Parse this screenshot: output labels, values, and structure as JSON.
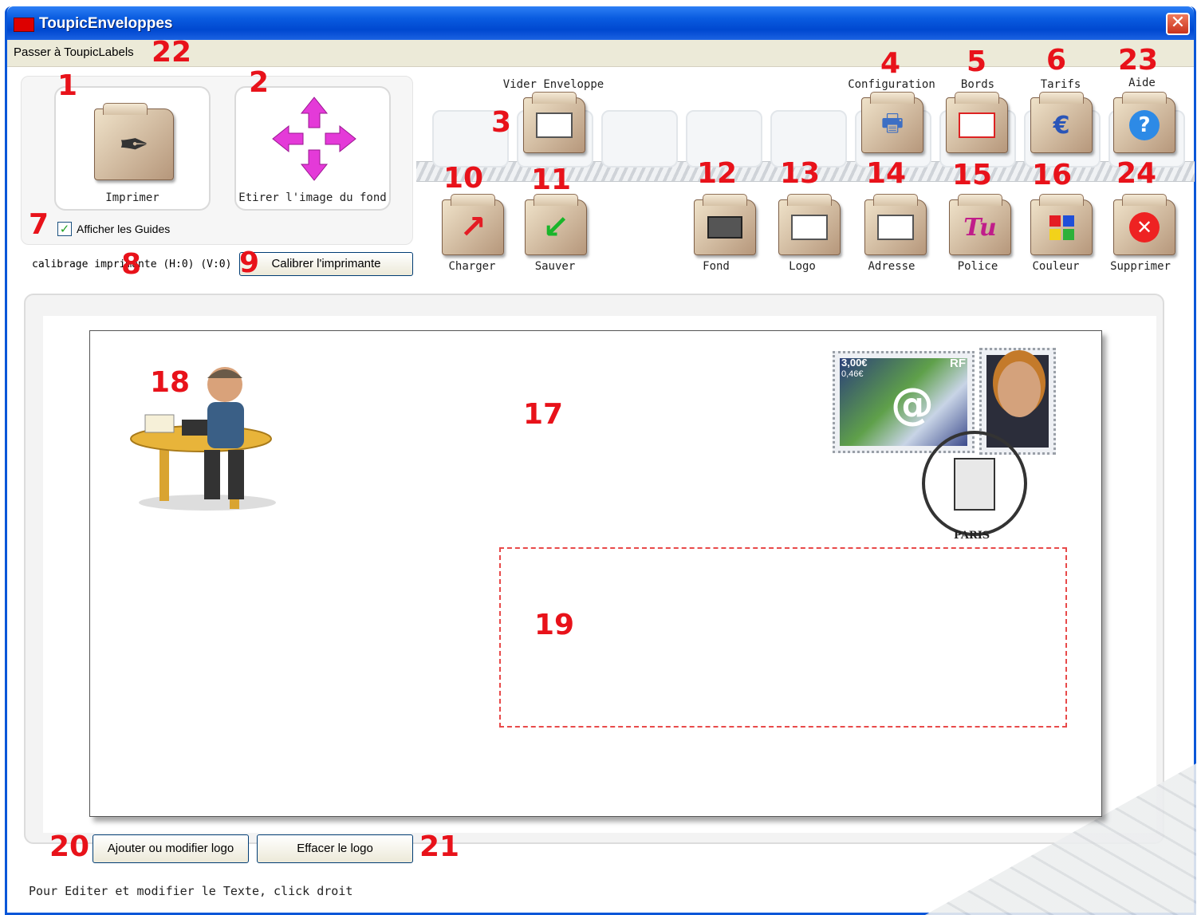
{
  "window": {
    "title": "ToupicEnveloppes",
    "close_symbol": "✕"
  },
  "menubar": {
    "switch_label": "Passer à ToupicLabels"
  },
  "left_panel": {
    "print_label": "Imprimer",
    "stretch_label": "Etirer l'image du fond",
    "show_guides_label": "Afficher les Guides",
    "show_guides_checked": true,
    "calibration_text": "calibrage imprimante (H:0) (V:0)",
    "calibrate_button": "Calibrer l'imprimante"
  },
  "toolbar_top": {
    "empty_envelope": "Vider Enveloppe",
    "configuration": "Configuration",
    "borders": "Bords",
    "rates": "Tarifs",
    "help": "Aide"
  },
  "toolbar_bottom": {
    "load": "Charger",
    "save": "Sauver",
    "background": "Fond",
    "logo": "Logo",
    "address": "Adresse",
    "font": "Police",
    "color": "Couleur",
    "delete": "Supprimer"
  },
  "callouts": [
    "1",
    "2",
    "3",
    "4",
    "5",
    "6",
    "7",
    "8",
    "9",
    "10",
    "11",
    "12",
    "13",
    "14",
    "15",
    "16",
    "17",
    "18",
    "19",
    "20",
    "21",
    "22",
    "23",
    "24"
  ],
  "envelope": {
    "stamp_value": "3,00€",
    "stamp_value_sub": "0,46€",
    "stamp_country": "RF",
    "postmark_city": "PARIS"
  },
  "bottom_buttons": {
    "add_logo": "Ajouter ou modifier logo",
    "clear_logo": "Effacer le logo"
  },
  "status_text": "Pour Editer et modifier le Texte, click droit",
  "colors": {
    "title_bar": "#0a5ce0",
    "callout": "#e8121a",
    "address_guide": "#e84a4a",
    "menubar": "#ecead8"
  }
}
